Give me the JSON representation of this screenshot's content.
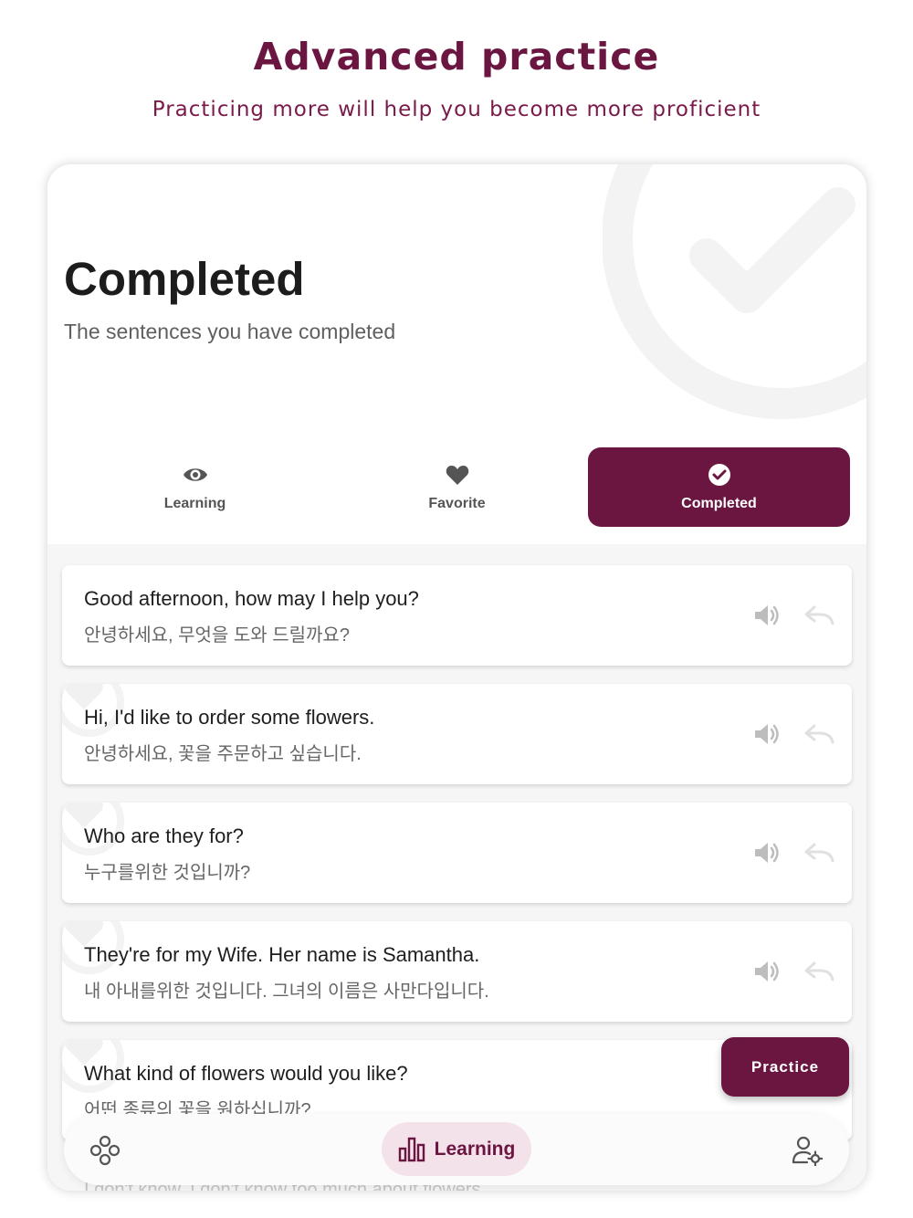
{
  "header": {
    "title": "Advanced practice",
    "subtitle": "Practicing more will help you become more proficient"
  },
  "section": {
    "title": "Completed",
    "subtitle": "The sentences you have completed"
  },
  "tabs": [
    {
      "label": "Learning",
      "icon": "eye-icon",
      "active": false
    },
    {
      "label": "Favorite",
      "icon": "heart-icon",
      "active": false
    },
    {
      "label": "Completed",
      "icon": "check-circle-icon",
      "active": true
    }
  ],
  "sentences": [
    {
      "en": "Good afternoon, how may I help you?",
      "ko": "안녕하세요, 무엇을 도와 드릴까요?"
    },
    {
      "en": "Hi, I'd like to order some flowers.",
      "ko": "안녕하세요, 꽃을 주문하고 싶습니다."
    },
    {
      "en": "Who are they for?",
      "ko": "누구를위한 것입니까?"
    },
    {
      "en": "They're for my Wife. Her name is Samantha.",
      "ko": "내 아내를위한 것입니다. 그녀의 이름은 사만다입니다."
    },
    {
      "en": "What kind of flowers would you like?",
      "ko": "어떤 종류의 꽃을 원하십니까?"
    }
  ],
  "trailing_sentence": "I don't know. I don't know too much about flowers.",
  "practice_button": "Practice",
  "bottom_nav": {
    "left_icon": "molecule-icon",
    "center_label": "Learning",
    "center_icon": "bar-chart-icon",
    "right_icon": "user-settings-icon"
  },
  "colors": {
    "accent": "#6b1541",
    "nav_highlight": "#f3e2ea"
  }
}
